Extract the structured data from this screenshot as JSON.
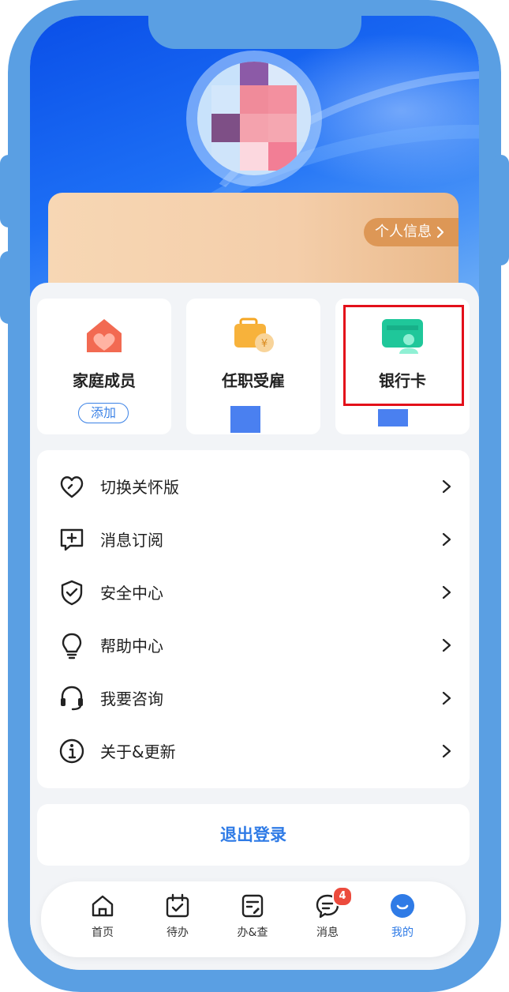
{
  "profile": {
    "info_link_label": "个人信息"
  },
  "quick_tiles": [
    {
      "title": "家庭成员",
      "action_label": "添加",
      "icon": "house-heart-icon"
    },
    {
      "title": "任职受雇",
      "icon": "briefcase-money-icon"
    },
    {
      "title": "银行卡",
      "icon": "bank-card-icon",
      "highlighted": true
    }
  ],
  "menu": {
    "items": [
      {
        "label": "切换关怀版",
        "icon": "heart-icon"
      },
      {
        "label": "消息订阅",
        "icon": "message-add-icon"
      },
      {
        "label": "安全中心",
        "icon": "shield-check-icon"
      },
      {
        "label": "帮助中心",
        "icon": "lightbulb-icon"
      },
      {
        "label": "我要咨询",
        "icon": "headset-icon"
      },
      {
        "label": "关于&更新",
        "icon": "info-icon"
      }
    ]
  },
  "logout": {
    "label": "退出登录"
  },
  "tabbar": {
    "tabs": [
      {
        "label": "首页",
        "icon": "home-icon"
      },
      {
        "label": "待办",
        "icon": "calendar-check-icon"
      },
      {
        "label": "办&查",
        "icon": "document-edit-icon"
      },
      {
        "label": "消息",
        "icon": "chat-bubble-icon",
        "badge": "4"
      },
      {
        "label": "我的",
        "icon": "profile-smile-icon",
        "active": true
      }
    ]
  },
  "colors": {
    "frame": "#5a9fe3",
    "accent": "#2f7be6",
    "highlight_border": "#e3101a",
    "badge": "#ec4b3d"
  }
}
